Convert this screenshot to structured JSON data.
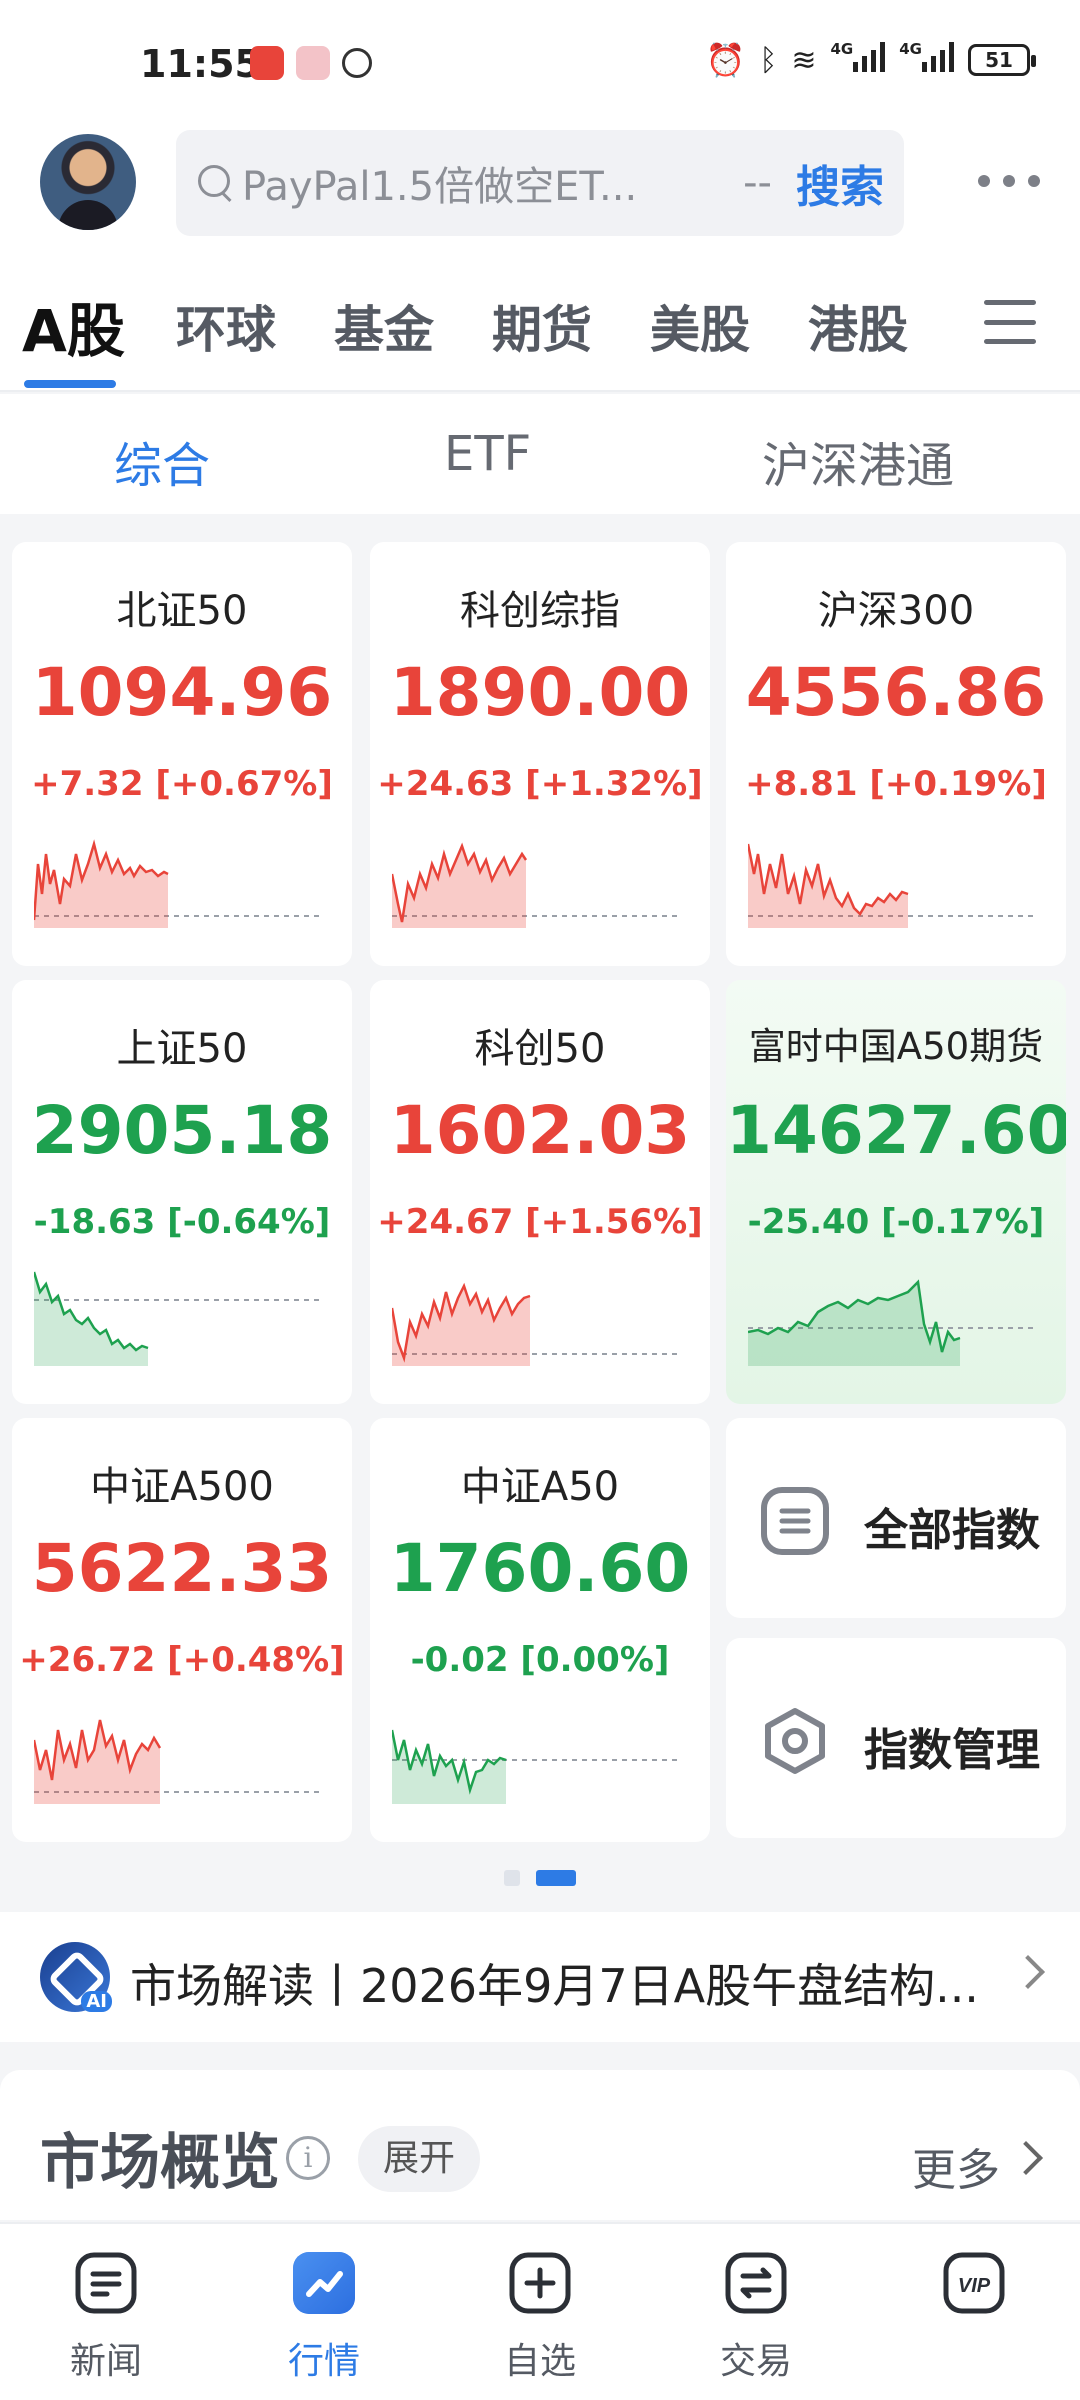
{
  "status_bar": {
    "time": "11:55",
    "signal1": "4G",
    "signal2": "4G",
    "battery": "51"
  },
  "search": {
    "placeholder": "PayPal1.5倍做空ET...",
    "dash": "--",
    "button": "搜索"
  },
  "market_tabs": [
    "A股",
    "环球",
    "基金",
    "期货",
    "美股",
    "港股"
  ],
  "sub_tabs": [
    "综合",
    "ETF",
    "沪深港通"
  ],
  "indices": [
    {
      "name": "北证50",
      "price": "1094.96",
      "change": "+7.32 [+0.67%]",
      "trend": "up"
    },
    {
      "name": "科创综指",
      "price": "1890.00",
      "change": "+24.63 [+1.32%]",
      "trend": "up"
    },
    {
      "name": "沪深300",
      "price": "4556.86",
      "change": "+8.81 [+0.19%]",
      "trend": "up"
    },
    {
      "name": "上证50",
      "price": "2905.18",
      "change": "-18.63 [-0.64%]",
      "trend": "down"
    },
    {
      "name": "科创50",
      "price": "1602.03",
      "change": "+24.67 [+1.56%]",
      "trend": "up"
    },
    {
      "name": "富时中国A50期货",
      "price": "14627.60",
      "change": "-25.40 [-0.17%]",
      "trend": "down"
    },
    {
      "name": "中证A500",
      "price": "5622.33",
      "change": "+26.72 [+0.48%]",
      "trend": "up"
    },
    {
      "name": "中证A50",
      "price": "1760.60",
      "change": "-0.02 [0.00%]",
      "trend": "down"
    }
  ],
  "actions": {
    "all_indices": "全部指数",
    "index_manage": "指数管理"
  },
  "market_reading": {
    "text": "市场解读丨2026年9月7日A股午盘结构..."
  },
  "overview": {
    "title": "市场概览",
    "expand": "展开",
    "more": "更多"
  },
  "bottom_nav": [
    {
      "label": "新闻",
      "icon": "news-icon"
    },
    {
      "label": "行情",
      "icon": "quotes-icon"
    },
    {
      "label": "自选",
      "icon": "watchlist-add-icon"
    },
    {
      "label": "交易",
      "icon": "trade-icon"
    },
    {
      "label": "",
      "icon": "vip-icon"
    }
  ],
  "colors": {
    "accent": "#2d7be5",
    "up": "#e8443a",
    "down": "#1ea14f"
  }
}
